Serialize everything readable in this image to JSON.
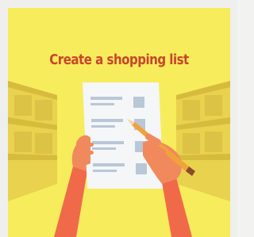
{
  "title": "Create a shopping list",
  "colors": {
    "background": "#f7ec5c",
    "shelf": "#e8d04a",
    "shelf_dark": "#d9bc3a",
    "title": "#c8462c",
    "paper": "#f4f6f8",
    "skin": "#f08a5d",
    "sleeve": "#f06a4a",
    "pencil": "#f2a23a",
    "list_line": "#b9c7d6",
    "checkbox": "#b9c7d6"
  },
  "icons": {
    "left_shelf": "shelf-icon",
    "right_shelf": "shelf-icon",
    "list": "shopping-list-icon",
    "pencil": "pencil-icon"
  }
}
